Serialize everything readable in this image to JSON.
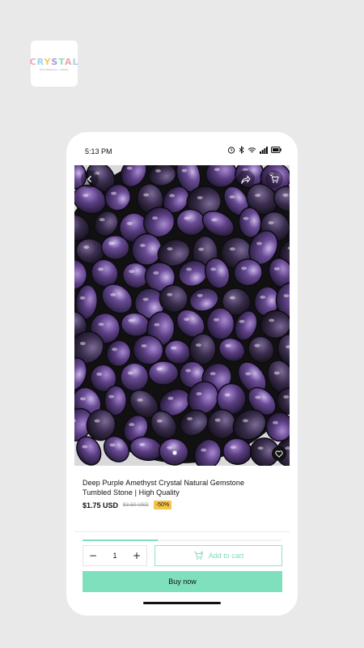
{
  "logo": {
    "letters": [
      "C",
      "R",
      "Y",
      "S",
      "T",
      "A",
      "L"
    ],
    "subtitle": "WONDERFUL GEMS"
  },
  "status_bar": {
    "time": "5:13 PM"
  },
  "hero": {
    "image_alt": "Deep purple amethyst tumbled stones in a black bowl",
    "carousel_active_index": 0,
    "carousel_count": 1
  },
  "product": {
    "title": "Deep Purple Amethyst Crystal Natural Gemstone Tumbled Stone | High Quality",
    "price": "$1.75 USD",
    "compare_price": "$3.50 USD",
    "discount_badge": "-50%"
  },
  "purchase": {
    "quantity": "1",
    "decrement_label": "−",
    "increment_label": "+",
    "add_to_cart_label": "Add to cart",
    "buy_now_label": "Buy now",
    "progress_fraction": 0.38
  },
  "colors": {
    "accent": "#7fe0bd",
    "badge": "#f7c548",
    "background": "#e9e9e9"
  }
}
